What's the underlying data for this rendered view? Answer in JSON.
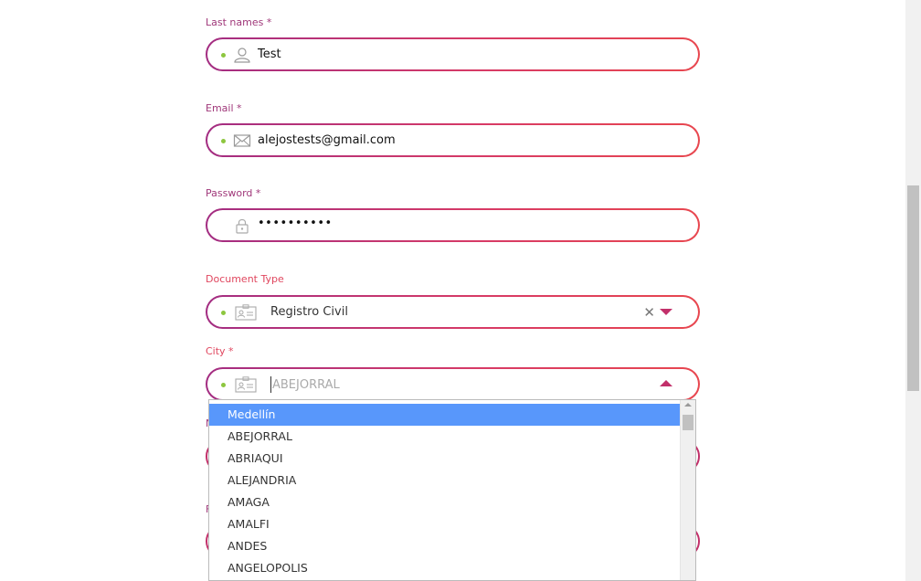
{
  "form": {
    "last_names": {
      "label": "Last names *",
      "value": "Test",
      "icon": "person-icon"
    },
    "email": {
      "label": "Email *",
      "value": "alejostests@gmail.com",
      "icon": "envelope-icon"
    },
    "password": {
      "label": "Password *",
      "value": "••••••••••",
      "icon": "lock-icon"
    },
    "document_type": {
      "label": "Document Type",
      "value": "Registro Civil",
      "clear": "✕",
      "icon": "id-card-icon"
    },
    "city": {
      "label": "City *",
      "placeholder": "ABEJORRAL",
      "icon": "id-card-icon"
    }
  },
  "city_dropdown": {
    "options": [
      "Medellín",
      "ABEJORRAL",
      "ABRIAQUI",
      "ALEJANDRIA",
      "AMAGA",
      "AMALFI",
      "ANDES",
      "ANGELOPOLIS"
    ],
    "highlighted_index": 0
  },
  "colors": {
    "label": "#a0387a",
    "label_alt": "#e0475f",
    "border_start": "#a32d82",
    "border_end": "#e8474f",
    "valid_dot": "#8dc63f",
    "highlight": "#5897fb"
  }
}
